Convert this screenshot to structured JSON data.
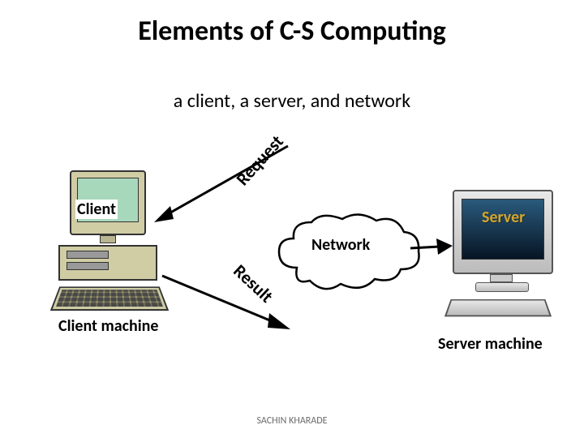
{
  "title": "Elements of C-S Computing",
  "subtitle": "a client, a server, and network",
  "labels": {
    "client": "Client",
    "server": "Server",
    "network": "Network",
    "client_machine": "Client machine",
    "server_machine": "Server machine",
    "request": "Request",
    "result": "Result"
  },
  "footer": "SACHIN KHARADE",
  "icons": {
    "client_computer": "client-computer-icon",
    "server_computer": "server-computer-icon",
    "network_cloud": "cloud-icon"
  },
  "colors": {
    "server_label": "#d4a62a"
  }
}
